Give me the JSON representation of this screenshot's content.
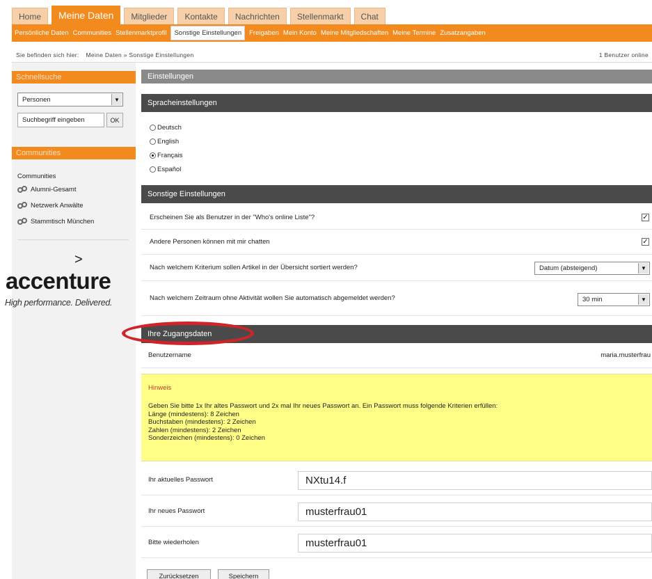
{
  "nav": {
    "tabs": [
      "Home",
      "Meine Daten",
      "Mitglieder",
      "Kontakte",
      "Nachrichten",
      "Stellenmarkt",
      "Chat"
    ],
    "active_tab": "Meine Daten",
    "subnav": [
      "Persönliche Daten",
      "Communities",
      "Stellenmarktprofil",
      "Sonstige Einstellungen",
      "Freigaben",
      "Mein Konto",
      "Meine Mitgliedschaften",
      "Meine Termine",
      "Zusatzangaben"
    ],
    "active_subnav": "Sonstige Einstellungen"
  },
  "breadcrumb": {
    "prefix": "Sie befinden sich hier:",
    "path": "Meine Daten » Sonstige Einstellungen",
    "online": "1 Benutzer online"
  },
  "sidebar": {
    "quicksearch_title": "Schnellsuche",
    "search_type": "Personen",
    "search_placeholder": "Suchbegriff eingeben",
    "ok_label": "OK",
    "communities_title": "Communities",
    "communities_label": "Communities",
    "communities": [
      "Alumni-Gesamt",
      "Netzwerk Anwälte",
      "Stammtisch München"
    ],
    "logo_text": "accenture",
    "logo_tagline": "High performance. Delivered."
  },
  "main": {
    "settings_title": "Einstellungen",
    "language_title": "Spracheinstellungen",
    "languages": [
      {
        "label": "Deutsch",
        "selected": false
      },
      {
        "label": "English",
        "selected": false
      },
      {
        "label": "Français",
        "selected": true
      },
      {
        "label": "Español",
        "selected": false
      }
    ],
    "other_title": "Sonstige Einstellungen",
    "other_rows": [
      {
        "label": "Erscheinen Sie als Benutzer in der \"Who's online Liste\"?",
        "checked": true
      },
      {
        "label": "Andere Personen können mit mir chatten",
        "checked": true
      }
    ],
    "sort_question": "Nach welchem Kriterium sollen Artikel in der Übersicht sortiert werden?",
    "sort_value": "Datum (absteigend)",
    "timeout_question": "Nach welchem Zeitraum ohne Aktivität wollen Sie automatisch abgemeldet werden?",
    "timeout_value": "30 min",
    "access_title": "Ihre Zugangsdaten",
    "username_label": "Benutzername",
    "username_value": "maria.musterfrau",
    "hint_title": "Hinweis",
    "hint_lines": [
      "Geben Sie bitte 1x Ihr altes Passwort und 2x mal Ihr neues Passwort an. Ein Passwort muss folgende Kriterien erfüllen:",
      "Länge (mindestens): 8 Zeichen",
      "Buchstaben (mindestens): 2 Zeichen",
      "Zahlen (mindestens): 2 Zeichen",
      "Sonderzeichen (mindestens): 0 Zeichen"
    ],
    "current_pw_label": "Ihr aktuelles Passwort",
    "current_pw_value": "NXtu14.f",
    "new_pw_label": "Ihr neues Passwort",
    "new_pw_value": "musterfrau01",
    "repeat_pw_label": "Bitte wiederholen",
    "repeat_pw_value": "musterfrau01",
    "reset_label": "Zurücksetzen",
    "save_label": "Speichern"
  },
  "colors": {
    "orange": "#f28a1d",
    "dark_bar": "#4a4a4a",
    "hint_bg": "#ffff88",
    "highlight": "#d0242b"
  }
}
